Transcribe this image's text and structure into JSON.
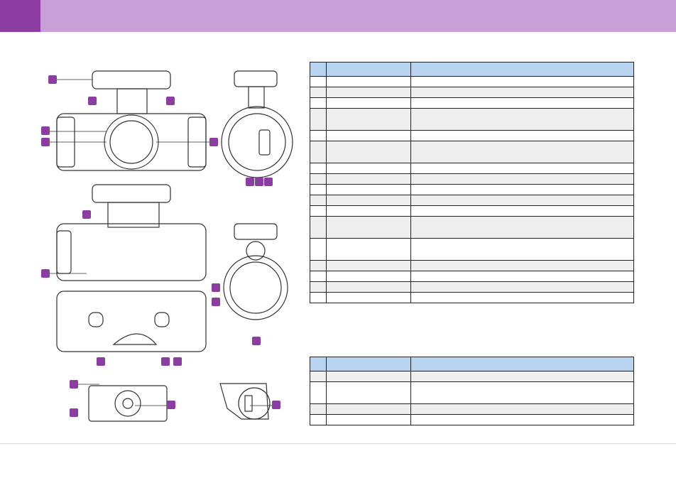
{
  "header": {
    "accent": "#8c3da2",
    "bar": "#c89fd6"
  },
  "callout_color": "#8c3da2",
  "table_header_color": "#b9d4f0",
  "table1": {
    "rows": [
      "r1",
      "r2",
      "r1",
      "r1",
      "r2",
      "r1",
      "r2",
      "r1",
      "r1",
      "r1",
      "r1",
      "r1",
      "r2",
      "r2",
      "r1",
      "r1",
      "r1",
      "r1"
    ]
  },
  "table2": {
    "rows": [
      "r1",
      "r2",
      "r1",
      "r1"
    ]
  },
  "icons": [
    "camera-front-view",
    "camera-side-view",
    "camera-top-view",
    "camera-rear-view",
    "mount-bottom-view",
    "mount-side-view"
  ]
}
